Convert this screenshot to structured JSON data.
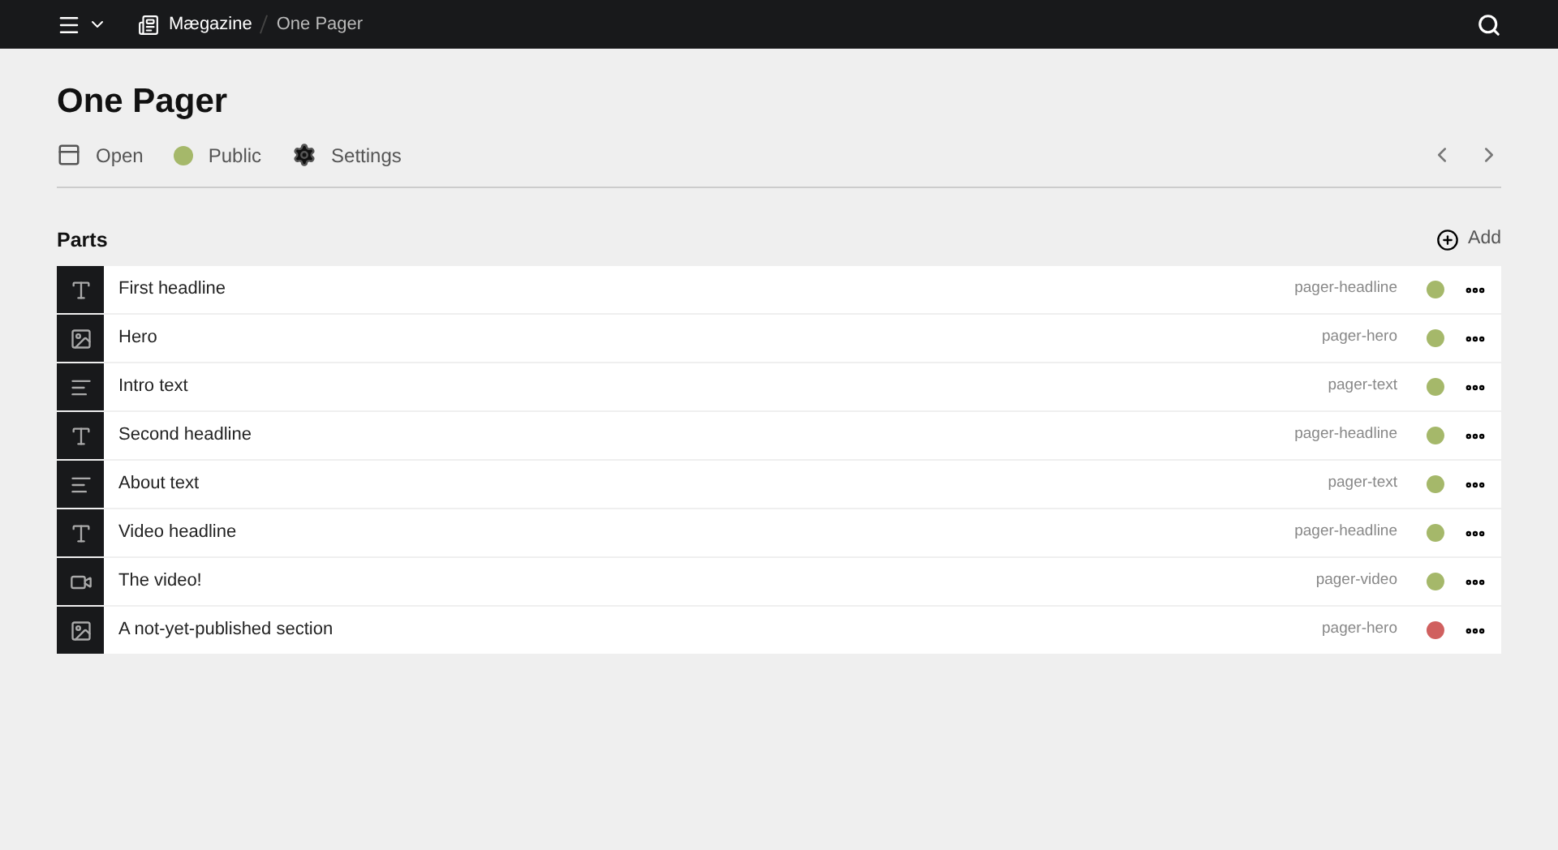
{
  "breadcrumb": {
    "site": "Mægazine",
    "page": "One Pager"
  },
  "title": "One Pager",
  "actions": [
    {
      "kind": "open",
      "label": "Open"
    },
    {
      "kind": "status",
      "label": "Public",
      "color": "#a5b86a"
    },
    {
      "kind": "settings",
      "label": "Settings"
    }
  ],
  "parts": {
    "title": "Parts",
    "add_label": "Add",
    "items": [
      {
        "kind": "headline",
        "name": "First headline",
        "type": "pager-headline",
        "color": "#a5b86a"
      },
      {
        "kind": "image",
        "name": "Hero",
        "type": "pager-hero",
        "color": "#a5b86a"
      },
      {
        "kind": "text",
        "name": "Intro text",
        "type": "pager-text",
        "color": "#a5b86a"
      },
      {
        "kind": "headline",
        "name": "Second headline",
        "type": "pager-headline",
        "color": "#a5b86a"
      },
      {
        "kind": "text",
        "name": "About text",
        "type": "pager-text",
        "color": "#a5b86a"
      },
      {
        "kind": "headline",
        "name": "Video headline",
        "type": "pager-headline",
        "color": "#a5b86a"
      },
      {
        "kind": "video",
        "name": "The video!",
        "type": "pager-video",
        "color": "#a5b86a"
      },
      {
        "kind": "image",
        "name": "A not-yet-published section",
        "type": "pager-hero",
        "color": "#d0605f"
      }
    ]
  }
}
